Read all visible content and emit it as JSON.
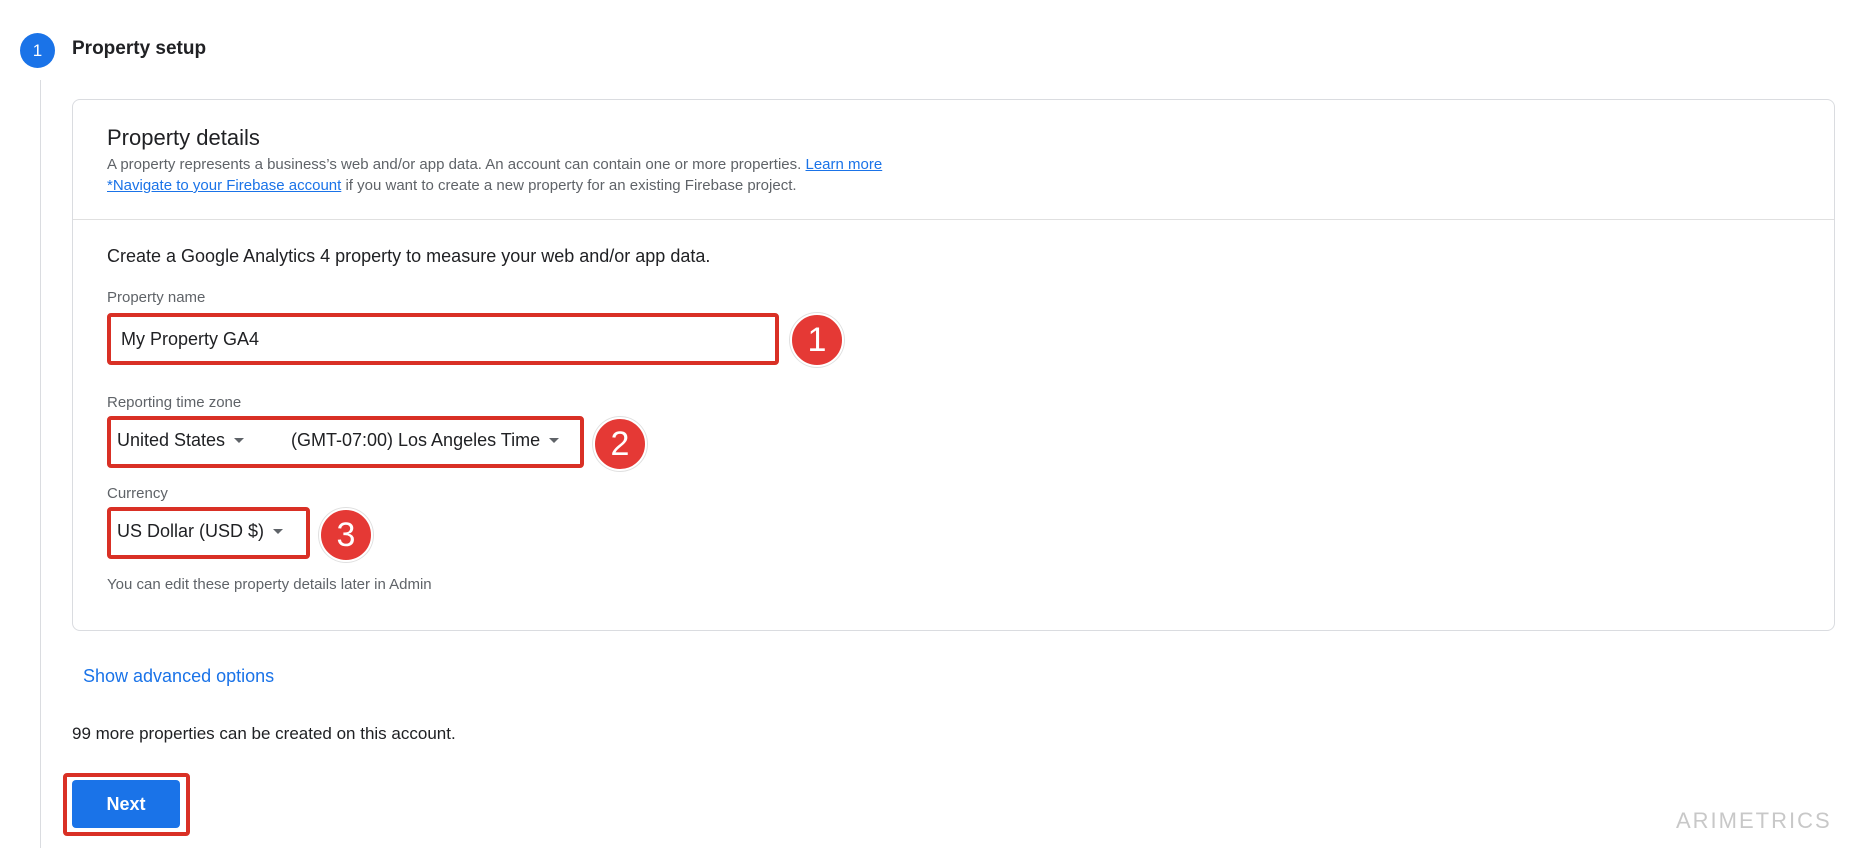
{
  "step": {
    "number": "1",
    "title": "Property setup"
  },
  "card": {
    "title": "Property details",
    "description_1": "A property represents a business’s web and/or app data. An account can contain one or more properties.",
    "learn_more": "Learn more",
    "firebase_link": "*Navigate to your Firebase account",
    "description_2": " if you want to create a new property for an existing Firebase project."
  },
  "form": {
    "intro": "Create a Google Analytics 4 property to measure your web and/or app data.",
    "property_name_label": "Property name",
    "property_name_value": "My Property GA4",
    "timezone_label": "Reporting time zone",
    "country": "United States",
    "timezone": "(GMT-07:00) Los Angeles Time",
    "currency_label": "Currency",
    "currency": "US Dollar (USD $)",
    "hint": "You can edit these property details later in Admin"
  },
  "annotations": [
    "1",
    "2",
    "3"
  ],
  "advanced_options": "Show advanced options",
  "remaining_text": "99 more properties can be created on this account.",
  "next_button": "Next",
  "watermark": "ARIMETRICS",
  "colors": {
    "accent": "#1a73e8",
    "highlight": "#d93025",
    "badge": "#e53935"
  }
}
